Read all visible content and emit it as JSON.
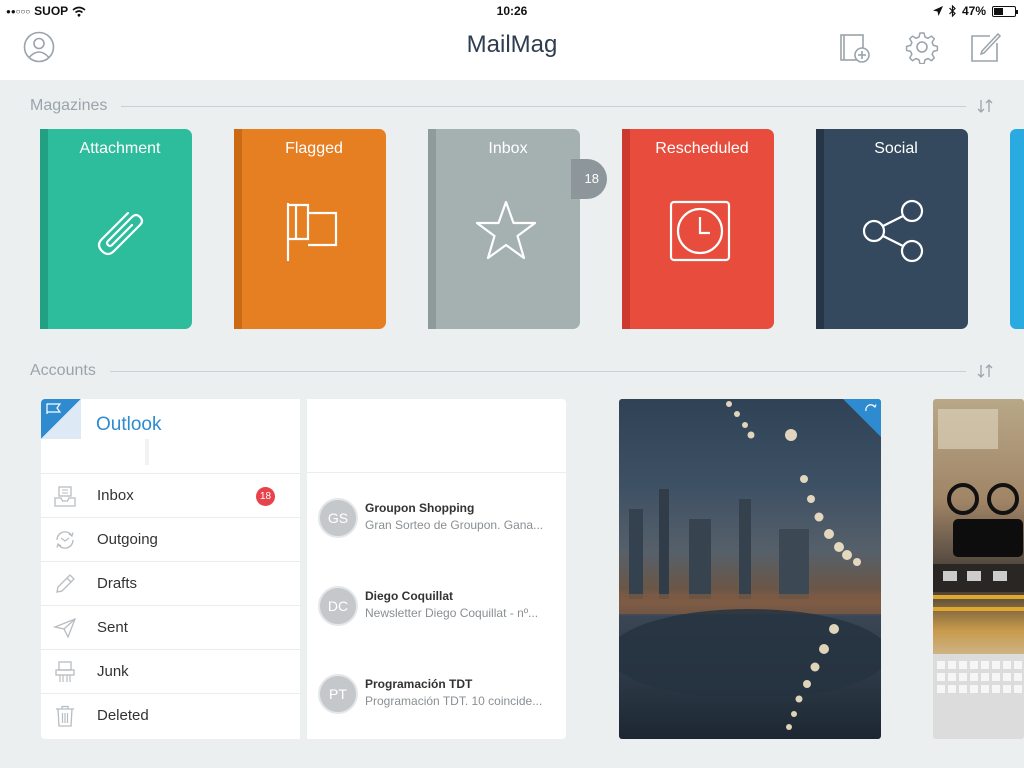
{
  "status_bar": {
    "signal": "●●○○○",
    "carrier": "SUOP",
    "time": "10:26",
    "battery": "47%",
    "battery_level": 0.47
  },
  "header": {
    "title": "MailMag",
    "icons": [
      "profile-icon",
      "new-magazine-icon",
      "gear-icon",
      "compose-icon"
    ]
  },
  "magazines": {
    "heading": "Magazines",
    "items": [
      {
        "title": "Attachment",
        "icon": "paperclip-icon",
        "color": "#2dbc9c",
        "spine": "#22a083"
      },
      {
        "title": "Flagged",
        "icon": "flag-icon",
        "color": "#e67e22",
        "spine": "#cc6a14"
      },
      {
        "title": "Inbox",
        "icon": "star-icon",
        "color": "#a5b1b1",
        "spine": "#8f9a9b",
        "badge": "18"
      },
      {
        "title": "Rescheduled",
        "icon": "clock-icon",
        "color": "#e74c3c",
        "spine": "#cb3a2c"
      },
      {
        "title": "Social",
        "icon": "share-icon",
        "color": "#34495e",
        "spine": "#263646"
      }
    ]
  },
  "accounts": {
    "heading": "Accounts",
    "account_name": "Outlook",
    "folders": [
      {
        "label": "Inbox",
        "icon": "inbox-tray-icon",
        "badge": "18"
      },
      {
        "label": "Outgoing",
        "icon": "outgoing-sync-icon"
      },
      {
        "label": "Drafts",
        "icon": "pencil-icon"
      },
      {
        "label": "Sent",
        "icon": "paper-plane-icon"
      },
      {
        "label": "Junk",
        "icon": "shredder-icon"
      },
      {
        "label": "Deleted",
        "icon": "trash-icon"
      }
    ],
    "messages": [
      {
        "initials": "GS",
        "sender": "Groupon Shopping",
        "preview": "Gran Sorteo de Groupon. Gana..."
      },
      {
        "initials": "DC",
        "sender": "Diego Coquillat",
        "preview": "Newsletter Diego Coquillat - nº..."
      },
      {
        "initials": "PT",
        "sender": "Programación TDT",
        "preview": "Programación TDT. 10 coincide..."
      }
    ]
  },
  "colors": {
    "accent": "#2e8bd0",
    "badge_red": "#e8434b",
    "background": "#eceff0"
  }
}
